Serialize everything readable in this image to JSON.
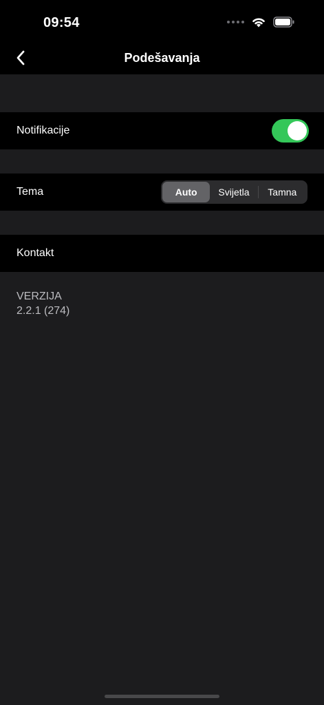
{
  "status": {
    "time": "09:54",
    "icons": [
      "signal-dots-icon",
      "wifi-icon",
      "battery-icon"
    ]
  },
  "nav": {
    "title": "Podešavanja",
    "back_icon": "chevron-left-icon"
  },
  "settings": {
    "notifications": {
      "label": "Notifikacije",
      "enabled": true
    },
    "theme": {
      "label": "Tema",
      "options": [
        "Auto",
        "Svijetla",
        "Tamna"
      ],
      "selected": "Auto"
    },
    "contact": {
      "label": "Kontakt"
    }
  },
  "version": {
    "label": "VERZIJA",
    "value": "2.2.1 (274)"
  },
  "colors": {
    "toggle_on": "#34c759",
    "background": "#1c1c1e",
    "row_background": "#000000"
  }
}
